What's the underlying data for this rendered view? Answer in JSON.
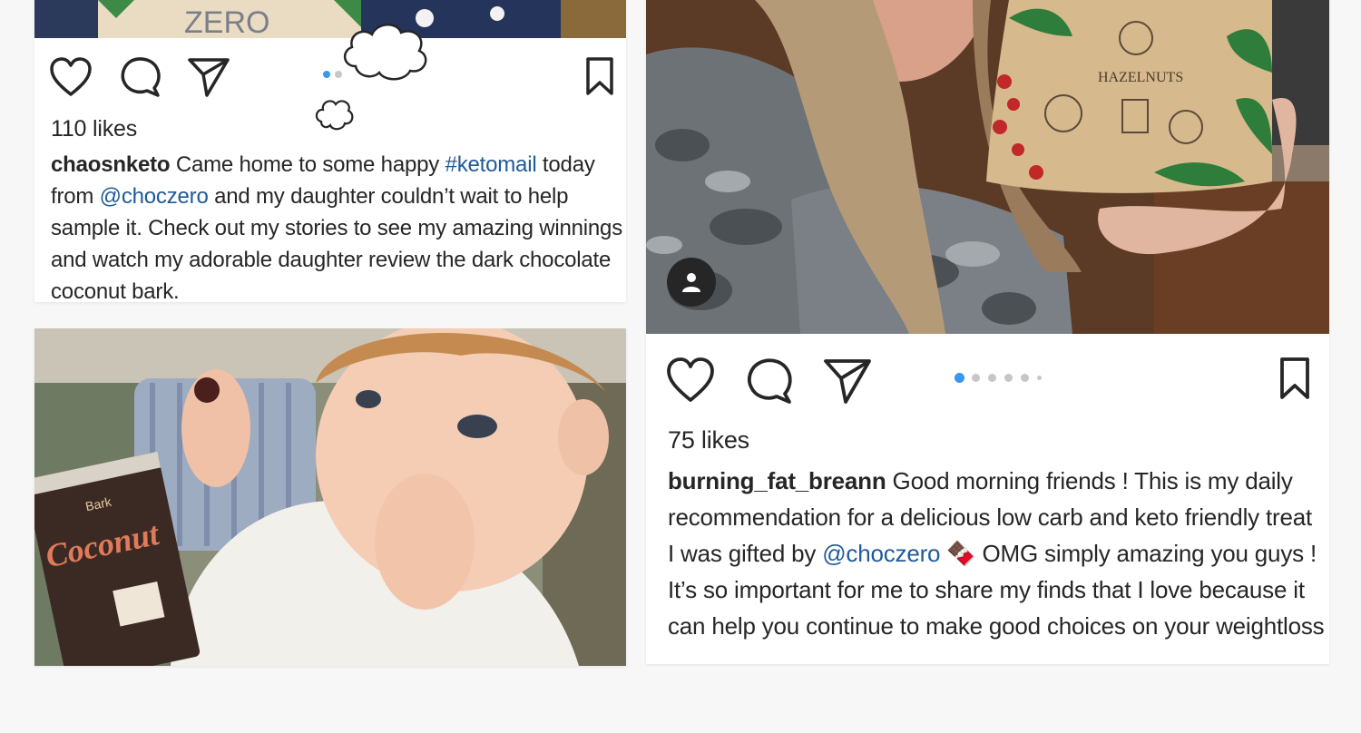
{
  "posts": [
    {
      "likes": "110 likes",
      "username": "chaosnketo",
      "caption_parts": [
        " Came home to some happy ",
        "#ketomail",
        " today from ",
        "@choczero",
        " and my daughter couldn’t wait to help sample it. Check out my stories to see my amazing winnings and watch my adorable daughter review the dark chocolate coconut bark."
      ],
      "product_text": "ZERO",
      "carousel_total": 2,
      "carousel_active": 1
    },
    {
      "likes": "75 likes",
      "username": "burning_fat_breann",
      "caption_parts": [
        " Good morning friends ! This is my daily recommendation for a delicious low carb and keto friendly treat I was gifted by ",
        "@choczero",
        " 🍫 OMG simply amazing you guys ! It’s so important for me to share my finds that I love because it can help you continue to make good choices on your weightloss"
      ],
      "product_text": "HAZELNUTS",
      "carousel_total": 6,
      "carousel_active": 1
    },
    {
      "product_text_small": "Bark",
      "product_text": "Coconut"
    }
  ],
  "icons": {
    "like": "heart-icon",
    "comment": "comment-icon",
    "share": "paper-plane-icon",
    "save": "bookmark-icon",
    "tagged": "person-icon"
  },
  "colors": {
    "link": "#1f5a9a",
    "dot_active": "#3897f0",
    "dot_inactive": "#c7c7c7",
    "background": "#f7f7f7"
  }
}
